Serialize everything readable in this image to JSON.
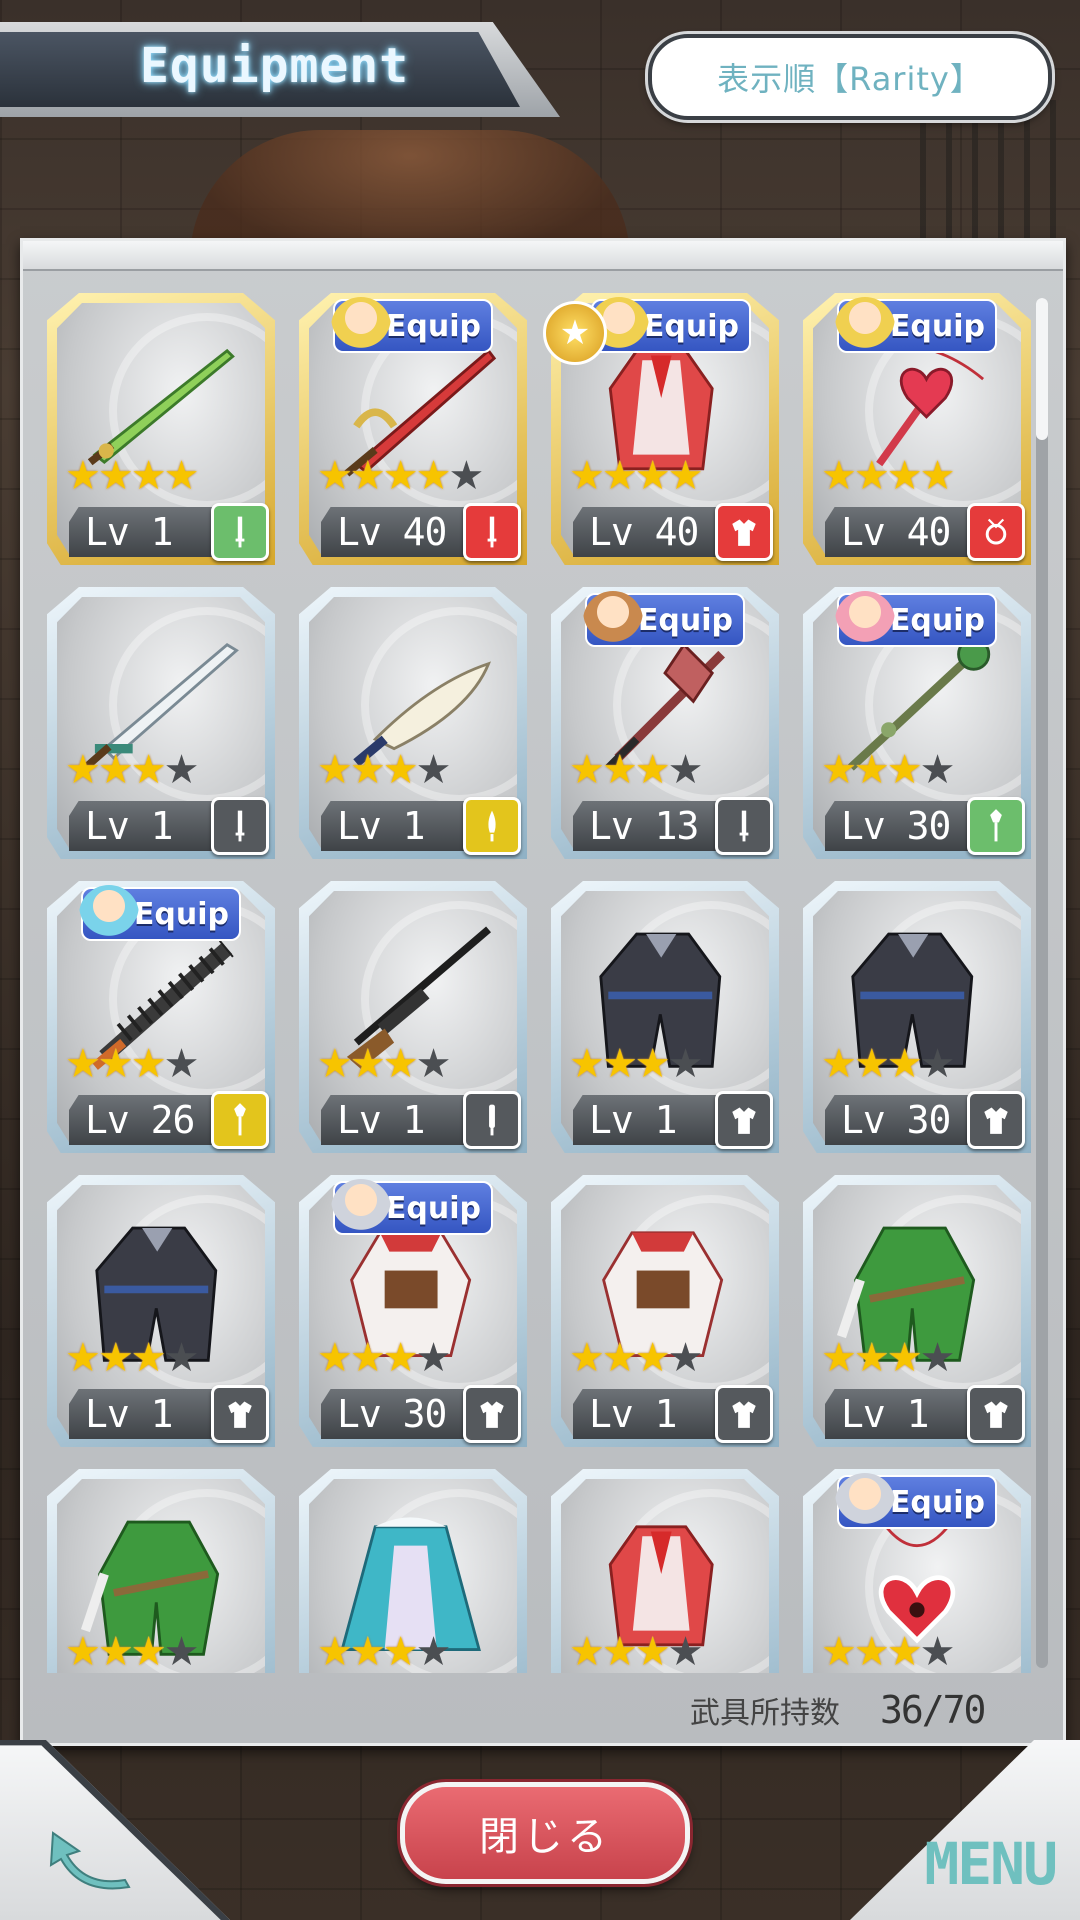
{
  "header": {
    "title": "Equipment",
    "sort_label": "表示順【Rarity】"
  },
  "equip_tag_label": "Equip",
  "items": [
    {
      "art": "green-sword",
      "frame": "gold",
      "stars": 4,
      "max": 4,
      "level": "Lv 1",
      "type": "sword",
      "badge": "green",
      "equip": null,
      "fav": false
    },
    {
      "art": "red-sword",
      "frame": "gold",
      "stars": 4,
      "max": 5,
      "level": "Lv 40",
      "type": "sword",
      "badge": "red",
      "equip": "yellow",
      "fav": false
    },
    {
      "art": "red-dress",
      "frame": "gold",
      "stars": 4,
      "max": 4,
      "level": "Lv 40",
      "type": "armor",
      "badge": "red",
      "equip": "yellow",
      "fav": true
    },
    {
      "art": "heart-key",
      "frame": "gold",
      "stars": 4,
      "max": 4,
      "level": "Lv 40",
      "type": "accessory",
      "badge": "red",
      "equip": "yellow",
      "fav": false
    },
    {
      "art": "silver-sword",
      "frame": "silver",
      "stars": 3,
      "max": 4,
      "level": "Lv 1",
      "type": "sword",
      "badge": "gray",
      "equip": null,
      "fav": false
    },
    {
      "art": "scimitar",
      "frame": "silver",
      "stars": 3,
      "max": 4,
      "level": "Lv 1",
      "type": "dagger",
      "badge": "yellow",
      "equip": null,
      "fav": false
    },
    {
      "art": "red-rapier",
      "frame": "silver",
      "stars": 3,
      "max": 4,
      "level": "Lv 13",
      "type": "sword",
      "badge": "gray",
      "equip": "brown",
      "fav": false
    },
    {
      "art": "green-mace",
      "frame": "silver",
      "stars": 3,
      "max": 4,
      "level": "Lv 30",
      "type": "mace",
      "badge": "green",
      "equip": "pink",
      "fav": false
    },
    {
      "art": "spiked-club",
      "frame": "silver",
      "stars": 3,
      "max": 4,
      "level": "Lv 26",
      "type": "mace",
      "badge": "yellow",
      "equip": "blue",
      "fav": false
    },
    {
      "art": "sniper-rifle",
      "frame": "silver",
      "stars": 3,
      "max": 4,
      "level": "Lv 1",
      "type": "gun",
      "badge": "gray",
      "equip": null,
      "fav": false
    },
    {
      "art": "black-coat",
      "frame": "silver",
      "stars": 3,
      "max": 4,
      "level": "Lv 1",
      "type": "armor",
      "badge": "gray",
      "equip": null,
      "fav": false
    },
    {
      "art": "black-coat",
      "frame": "silver",
      "stars": 3,
      "max": 4,
      "level": "Lv 30",
      "type": "armor",
      "badge": "gray",
      "equip": null,
      "fav": false
    },
    {
      "art": "black-coat",
      "frame": "silver",
      "stars": 3,
      "max": 4,
      "level": "Lv 1",
      "type": "armor",
      "badge": "gray",
      "equip": null,
      "fav": false
    },
    {
      "art": "red-white-armor",
      "frame": "silver",
      "stars": 3,
      "max": 4,
      "level": "Lv 30",
      "type": "armor",
      "badge": "gray",
      "equip": "silver",
      "fav": false
    },
    {
      "art": "red-white-armor",
      "frame": "silver",
      "stars": 3,
      "max": 4,
      "level": "Lv 1",
      "type": "armor",
      "badge": "gray",
      "equip": null,
      "fav": false
    },
    {
      "art": "green-armor",
      "frame": "silver",
      "stars": 3,
      "max": 4,
      "level": "Lv 1",
      "type": "armor",
      "badge": "gray",
      "equip": null,
      "fav": false
    },
    {
      "art": "green-armor",
      "frame": "silver",
      "stars": 3,
      "max": 4,
      "level": "",
      "type": "armor",
      "badge": "gray",
      "equip": null,
      "fav": false
    },
    {
      "art": "blue-robe",
      "frame": "silver",
      "stars": 3,
      "max": 4,
      "level": "",
      "type": "armor",
      "badge": "gray",
      "equip": null,
      "fav": false
    },
    {
      "art": "red-dress",
      "frame": "silver",
      "stars": 3,
      "max": 4,
      "level": "",
      "type": "armor",
      "badge": "gray",
      "equip": null,
      "fav": false
    },
    {
      "art": "heart-pendant",
      "frame": "silver",
      "stars": 3,
      "max": 4,
      "level": "",
      "type": "accessory",
      "badge": "gray",
      "equip": "silver",
      "fav": false
    }
  ],
  "owned": {
    "label": "武具所持数",
    "count": "36/70"
  },
  "footer": {
    "close_label": "閉じる",
    "menu_label": "MENU"
  }
}
